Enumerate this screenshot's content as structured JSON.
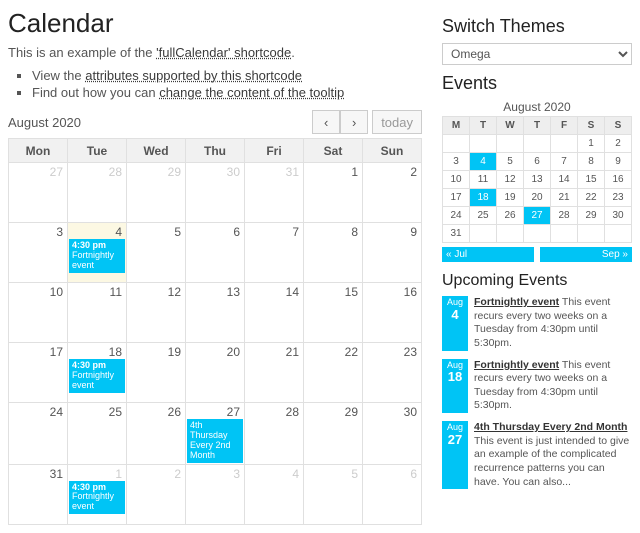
{
  "page": {
    "title": "Calendar",
    "intro": "This is an example of the ",
    "intro_link": "'fullCalendar' shortcode",
    "intro_suffix": ".",
    "bullets": [
      {
        "pre": "View the ",
        "link": "attributes supported by this shortcode"
      },
      {
        "pre": "Find out how you can ",
        "link": "change the content of the tooltip"
      }
    ]
  },
  "calendar": {
    "month_label": "August 2020",
    "today_label": "today",
    "day_headers": [
      "Mon",
      "Tue",
      "Wed",
      "Thu",
      "Fri",
      "Sat",
      "Sun"
    ],
    "weeks": [
      [
        {
          "n": 27,
          "o": true
        },
        {
          "n": 28,
          "o": true
        },
        {
          "n": 29,
          "o": true
        },
        {
          "n": 30,
          "o": true
        },
        {
          "n": 31,
          "o": true
        },
        {
          "n": 1
        },
        {
          "n": 2
        }
      ],
      [
        {
          "n": 3
        },
        {
          "n": 4,
          "today": true,
          "ev": {
            "time": "4:30 pm",
            "title": "Fortnightly event"
          }
        },
        {
          "n": 5
        },
        {
          "n": 6
        },
        {
          "n": 7
        },
        {
          "n": 8
        },
        {
          "n": 9
        }
      ],
      [
        {
          "n": 10
        },
        {
          "n": 11
        },
        {
          "n": 12
        },
        {
          "n": 13
        },
        {
          "n": 14
        },
        {
          "n": 15
        },
        {
          "n": 16
        }
      ],
      [
        {
          "n": 17
        },
        {
          "n": 18,
          "ev": {
            "time": "4:30 pm",
            "title": "Fortnightly event"
          }
        },
        {
          "n": 19
        },
        {
          "n": 20
        },
        {
          "n": 21
        },
        {
          "n": 22
        },
        {
          "n": 23
        }
      ],
      [
        {
          "n": 24
        },
        {
          "n": 25
        },
        {
          "n": 26
        },
        {
          "n": 27,
          "ev": {
            "title": "4th Thursday Every 2nd Month"
          }
        },
        {
          "n": 28
        },
        {
          "n": 29
        },
        {
          "n": 30
        }
      ],
      [
        {
          "n": 31
        },
        {
          "n": 1,
          "o": true,
          "ev": {
            "time": "4:30 pm",
            "title": "Fortnightly event"
          }
        },
        {
          "n": 2,
          "o": true
        },
        {
          "n": 3,
          "o": true
        },
        {
          "n": 4,
          "o": true
        },
        {
          "n": 5,
          "o": true
        },
        {
          "n": 6,
          "o": true
        }
      ]
    ]
  },
  "sidebar": {
    "themes_heading": "Switch Themes",
    "theme_selected": "Omega",
    "events_heading": "Events",
    "mini_caption": "August 2020",
    "mini_headers": [
      "M",
      "T",
      "W",
      "T",
      "F",
      "S",
      "S"
    ],
    "mini_weeks": [
      [
        {
          "n": "",
          "o": true
        },
        {
          "n": "",
          "o": true
        },
        {
          "n": "",
          "o": true
        },
        {
          "n": "",
          "o": true
        },
        {
          "n": "",
          "o": true
        },
        {
          "n": 1
        },
        {
          "n": 2
        }
      ],
      [
        {
          "n": 3
        },
        {
          "n": 4,
          "hl": true
        },
        {
          "n": 5
        },
        {
          "n": 6
        },
        {
          "n": 7
        },
        {
          "n": 8
        },
        {
          "n": 9
        }
      ],
      [
        {
          "n": 10
        },
        {
          "n": 11
        },
        {
          "n": 12
        },
        {
          "n": 13
        },
        {
          "n": 14
        },
        {
          "n": 15
        },
        {
          "n": 16
        }
      ],
      [
        {
          "n": 17
        },
        {
          "n": 18,
          "hl": true
        },
        {
          "n": 19
        },
        {
          "n": 20
        },
        {
          "n": 21
        },
        {
          "n": 22
        },
        {
          "n": 23
        }
      ],
      [
        {
          "n": 24
        },
        {
          "n": 25
        },
        {
          "n": 26
        },
        {
          "n": 27,
          "hl": true
        },
        {
          "n": 28
        },
        {
          "n": 29
        },
        {
          "n": 30
        }
      ],
      [
        {
          "n": 31
        },
        {
          "n": "",
          "o": true
        },
        {
          "n": "",
          "o": true
        },
        {
          "n": "",
          "o": true
        },
        {
          "n": "",
          "o": true
        },
        {
          "n": "",
          "o": true
        },
        {
          "n": "",
          "o": true
        }
      ]
    ],
    "prev_month": "« Jul",
    "next_month": "Sep »",
    "upcoming_heading": "Upcoming Events",
    "upcoming": [
      {
        "m": "Aug",
        "d": "4",
        "title": "Fortnightly event",
        "desc": " This event recurs every two weeks on a Tuesday from 4:30pm until 5:30pm."
      },
      {
        "m": "Aug",
        "d": "18",
        "title": "Fortnightly event",
        "desc": " This event recurs every two weeks on a Tuesday from 4:30pm until 5:30pm."
      },
      {
        "m": "Aug",
        "d": "27",
        "title": "4th Thursday Every 2nd Month",
        "desc": " This event is just intended to give an example of the complicated recurrence patterns you can have. You can also..."
      }
    ]
  }
}
